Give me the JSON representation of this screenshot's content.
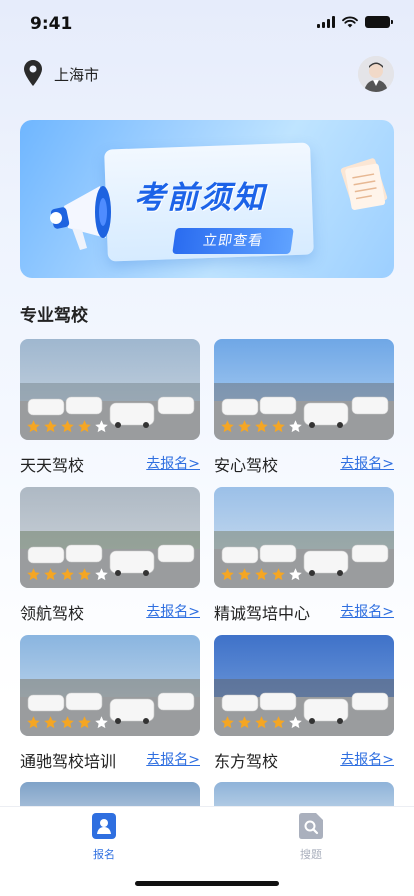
{
  "status_bar": {
    "time": "9:41"
  },
  "header": {
    "location": "上海市"
  },
  "banner": {
    "title": "考前须知",
    "button_label": "立即查看"
  },
  "section": {
    "title": "专业驾校"
  },
  "schools": [
    {
      "name": "天天驾校",
      "link": "去报名>",
      "rating": 4
    },
    {
      "name": "安心驾校",
      "link": "去报名>",
      "rating": 4
    },
    {
      "name": "领航驾校",
      "link": "去报名>",
      "rating": 4
    },
    {
      "name": "精诚驾培中心",
      "link": "去报名>",
      "rating": 4
    },
    {
      "name": "通驰驾校培训",
      "link": "去报名>",
      "rating": 4
    },
    {
      "name": "东方驾校",
      "link": "去报名>",
      "rating": 4
    }
  ],
  "tabbar": {
    "items": [
      {
        "label": "报名",
        "active": true,
        "icon": "person-badge-icon"
      },
      {
        "label": "搜题",
        "active": false,
        "icon": "search-doc-icon"
      }
    ]
  },
  "colors": {
    "accent": "#2f6fe0",
    "star": "#f5a623",
    "tab_active": "#2f6fe0",
    "tab_inactive": "#aab0bd"
  }
}
